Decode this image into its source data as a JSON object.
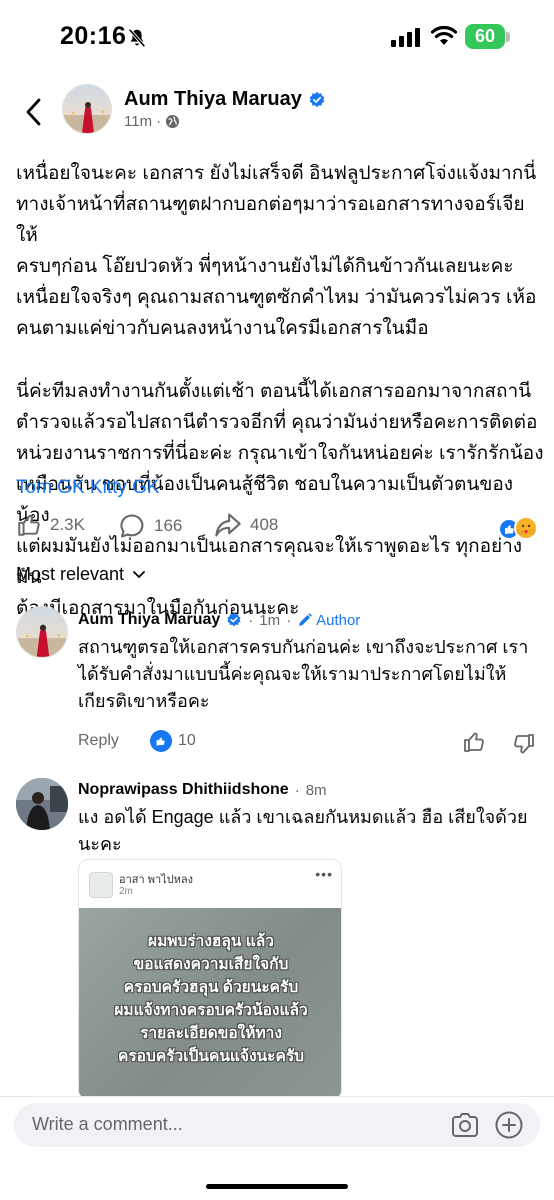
{
  "status_bar": {
    "time": "20:16",
    "battery": "60",
    "icons": [
      "bell-slash-icon",
      "signal-icon",
      "wifi-icon",
      "battery-icon"
    ]
  },
  "post": {
    "author": "Aum Thiya Maruay",
    "time": "11m",
    "body": [
      "เหนื่อยใจนะคะ เอกสาร ยังไม่เสร็จดี อินฟลูประกาศโจ่งแจ้งมากนี่\nทางเจ้าหน้าที่สถานฑูตฝากบอกต่อๆมาว่ารอเอกสารทางจอร์เจียให้\nครบๆก่อน โอ๊ยปวดหัว พี่ๆหน้างานยังไม่ได้กินข้าวกันเลยนะคะ\nเหนื่อยใจจริงๆ คุณถามสถานฑูตซักคำไหม ว่ามันควรไม่ควร เห้อ\nคนตามแค่ข่าวกับคนลงหน้างานใครมีเอกสารในมือ",
      "นี่ค่ะทีมลงทำงานกันตั้งแต่เช้า ตอนนี้ได้เอกสารออกมาจากสถานี\nตำรวจแล้วรอไปสถานีตำรวจอีกที่ คุณว่ามันง่ายหรือคะการติดต่อ\nหน่วยงานราชการที่นี่อะค่ะ กรุณาเข้าใจกันหน่อยค่ะ เรารักรักน้อง\nเหมือนกัน ชอบที่น้องเป็นคนสู้ชีวิต ชอบในความเป็นตัวตนของน้อง\nแต่ผมมันยังไม่ออกมาเป็นเอกสารคุณจะให้เราพูดอะไร ทุกอย่างมัน\nต้องมีเอกสารมาในมือกันก่อนนะคะ"
    ],
    "tags": "Tom GK Kitty GK",
    "likes": "2.3K",
    "comments": "166",
    "shares": "408"
  },
  "sort_label": "Most relevant",
  "comments": [
    {
      "author": "Aum Thiya Maruay",
      "time": "1m",
      "badge": "Author",
      "text": "สถานฑูตรอให้เอกสารครบกันก่อนค่ะ เขาถึงจะประกาศ เรา\nได้รับคำสั่งมาแบบนี้ค่ะคุณจะให้เรามาประกาศโดยไม่ให้\nเกียรติเขาหรือคะ",
      "reply_label": "Reply",
      "likes": "10"
    },
    {
      "author": "Noprawipass Dhithiidshone",
      "time": "8m",
      "text": "แง อดได้ Engage แล้ว เขาเฉลยกันหมดแล้ว ฮือ เสียใจด้วย\nนะคะ",
      "shared_card": {
        "page_name": "อาสา พาไปหลง",
        "time": "2m",
        "image_text": "ผมพบร่างฮลุน แล้ว\nขอแสดงความเสียใจกับ\nครอบครัวฮลุน ด้วยนะครับ\nผมแจ้งทางครอบครัวน้องแล้ว\nรายละเอียดขอให้ทาง\nครอบครัวเป็นคนแจ้งนะครับ"
      }
    }
  ],
  "composer": {
    "placeholder": "Write a comment..."
  },
  "colors": {
    "accent": "#1877f2",
    "battery": "#34c759",
    "secondary_text": "#65676b"
  }
}
